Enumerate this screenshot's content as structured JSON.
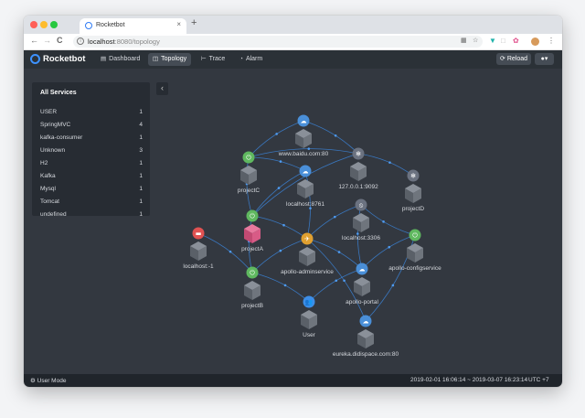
{
  "browser": {
    "tab_title": "Rocketbot",
    "tab_close": "×",
    "new_tab": "+",
    "url_host": "localhost",
    "url_path": ":8080/topology",
    "back": "←",
    "forward": "→",
    "reload": "C"
  },
  "app": {
    "brand": "Rocketbot",
    "nav": [
      {
        "label": "Dashboard",
        "icon": "dashboard-icon",
        "glyph": "▤"
      },
      {
        "label": "Topology",
        "icon": "topology-icon",
        "glyph": "◫"
      },
      {
        "label": "Trace",
        "icon": "trace-icon",
        "glyph": "⊢"
      },
      {
        "label": "Alarm",
        "icon": "alarm-icon",
        "glyph": "◔"
      }
    ],
    "reload_label": "Reload",
    "user_caret": "▾"
  },
  "services": {
    "title": "All Services",
    "items": [
      {
        "name": "USER",
        "count": "1"
      },
      {
        "name": "SpringMVC",
        "count": "4"
      },
      {
        "name": "kafka-consumer",
        "count": "1"
      },
      {
        "name": "Unknown",
        "count": "3"
      },
      {
        "name": "H2",
        "count": "1"
      },
      {
        "name": "Kafka",
        "count": "1"
      },
      {
        "name": "Mysql",
        "count": "1"
      },
      {
        "name": "Tomcat",
        "count": "1"
      },
      {
        "name": "undefined",
        "count": "1"
      }
    ],
    "collapse_glyph": "‹"
  },
  "topology": {
    "nodes": [
      {
        "id": "baidu",
        "label": "www.baidu.com:80",
        "icon": "cloud-icon",
        "glyph": "☁",
        "color": "#4a8fd8"
      },
      {
        "id": "projectC",
        "label": "projectC",
        "icon": "spring-icon",
        "glyph": "⏻",
        "color": "#5fb85f"
      },
      {
        "id": "ip127",
        "label": "127.0.0.1:9092",
        "icon": "kafka-icon",
        "glyph": "✻",
        "color": "#6b7280"
      },
      {
        "id": "projectD",
        "label": "projectD",
        "icon": "kafka-icon",
        "glyph": "✻",
        "color": "#6b7280"
      },
      {
        "id": "localhost8761",
        "label": "localhost:8761",
        "icon": "cloud-icon",
        "glyph": "☁",
        "color": "#4a8fd8"
      },
      {
        "id": "projectA",
        "label": "projectA",
        "icon": "spring-icon",
        "glyph": "⏻",
        "color": "#5fb85f"
      },
      {
        "id": "localhost3306",
        "label": "localhost:3306",
        "icon": "mysql-icon",
        "glyph": "⦸",
        "color": "#6b7280"
      },
      {
        "id": "localhost1",
        "label": "localhost:-1",
        "icon": "h2-icon",
        "glyph": "▬",
        "color": "#e05252"
      },
      {
        "id": "apolloAdmin",
        "label": "apollo-adminservice",
        "icon": "tomcat-icon",
        "glyph": "✈",
        "color": "#e0a030"
      },
      {
        "id": "apolloConfig",
        "label": "apollo-configservice",
        "icon": "spring-icon",
        "glyph": "⏻",
        "color": "#5fb85f"
      },
      {
        "id": "projectB",
        "label": "projectB",
        "icon": "spring-icon",
        "glyph": "⏻",
        "color": "#5fb85f"
      },
      {
        "id": "apolloPortal",
        "label": "apollo-portal",
        "icon": "cloud-icon",
        "glyph": "☁",
        "color": "#4a8fd8"
      },
      {
        "id": "user",
        "label": "User",
        "icon": "users-icon",
        "glyph": "👥",
        "color": "#3d8ee8"
      },
      {
        "id": "eureka",
        "label": "eureka.didispace.com:80",
        "icon": "cloud-icon",
        "glyph": "☁",
        "color": "#4a8fd8"
      }
    ]
  },
  "status": {
    "mode": "User Mode",
    "mode_glyph": "⚙",
    "range": "2019-02-01 16:06:14 ~ 2019-03-07 16:23:14",
    "timezone": "UTC +7"
  },
  "colors": {
    "accent": "#3d92ff",
    "edge": "#3b82d6",
    "background": "#333840",
    "panel": "#272c33"
  }
}
